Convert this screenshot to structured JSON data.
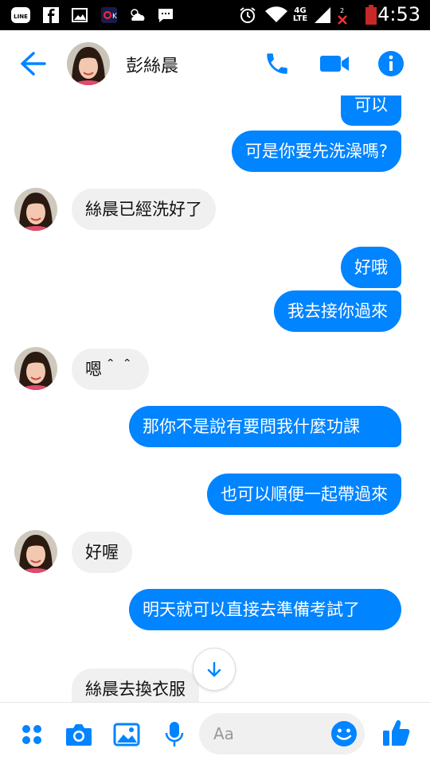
{
  "status_bar": {
    "time": "4:53",
    "network": "4G",
    "network_sub": "LTE",
    "left_icons": [
      "line-icon",
      "facebook-icon",
      "image-icon",
      "app-icon",
      "weather-icon",
      "chat-icon"
    ],
    "right_icons": [
      "alarm-icon",
      "wifi-icon",
      "signal-icon",
      "no-sim-icon",
      "battery-icon"
    ]
  },
  "header": {
    "contact_name": "彭絲晨",
    "icons": [
      "back-arrow-icon",
      "phone-icon",
      "video-camera-icon",
      "info-icon"
    ]
  },
  "messages": [
    {
      "from": "me",
      "text": "可以"
    },
    {
      "from": "me",
      "text": "可是你要先洗澡嗎?"
    },
    {
      "from": "them",
      "text": "絲晨已經洗好了"
    },
    {
      "from": "me",
      "text": "好哦"
    },
    {
      "from": "me",
      "text": "我去接你過來"
    },
    {
      "from": "them",
      "text": "嗯＾＾"
    },
    {
      "from": "me",
      "text": "那你不是說有要問我什麼功課"
    },
    {
      "from": "me",
      "text": "也可以順便一起帶過來"
    },
    {
      "from": "them",
      "text": "好喔"
    },
    {
      "from": "me",
      "text": "明天就可以直接去準備考試了"
    },
    {
      "from": "them",
      "text": "絲晨去換衣服"
    }
  ],
  "composer": {
    "placeholder": "Aa",
    "icons": [
      "menu-dots-icon",
      "camera-icon",
      "gallery-icon",
      "microphone-icon",
      "emoji-icon",
      "thumbs-up-icon"
    ]
  },
  "colors": {
    "accent": "#0084ff",
    "incoming_bubble": "#f1f0f0",
    "status_bar": "#000000"
  }
}
